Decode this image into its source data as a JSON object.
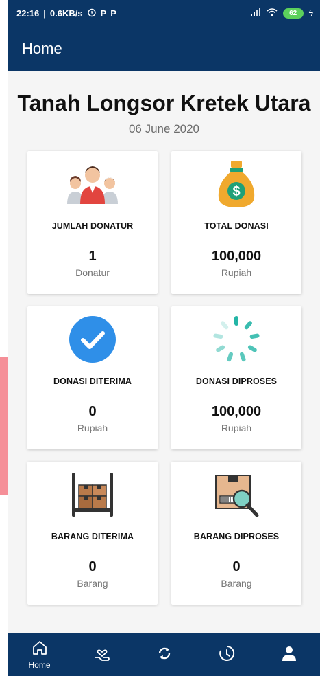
{
  "status_bar": {
    "time": "22:16",
    "speed": "0.6KB/s",
    "battery": "62"
  },
  "app_bar": {
    "title": "Home"
  },
  "header": {
    "title": "Tanah Longsor Kretek Utara",
    "date": "06 June 2020"
  },
  "cards": [
    {
      "icon": "donors-group-icon",
      "label": "JUMLAH DONATUR",
      "value": "1",
      "unit": "Donatur"
    },
    {
      "icon": "money-bag-icon",
      "label": "TOTAL DONASI",
      "value": "100,000",
      "unit": "Rupiah"
    },
    {
      "icon": "check-circle-icon",
      "label": "DONASI DITERIMA",
      "value": "0",
      "unit": "Rupiah"
    },
    {
      "icon": "loading-spinner-icon",
      "label": "DONASI DIPROSES",
      "value": "100,000",
      "unit": "Rupiah"
    },
    {
      "icon": "warehouse-boxes-icon",
      "label": "BARANG DITERIMA",
      "value": "0",
      "unit": "Barang"
    },
    {
      "icon": "box-search-icon",
      "label": "BARANG DIPROSES",
      "value": "0",
      "unit": "Barang"
    }
  ],
  "bottom_nav": [
    {
      "icon": "home-icon",
      "label": "Home"
    },
    {
      "icon": "donate-hand-icon",
      "label": ""
    },
    {
      "icon": "refresh-icon",
      "label": ""
    },
    {
      "icon": "history-clock-icon",
      "label": ""
    },
    {
      "icon": "profile-icon",
      "label": ""
    }
  ],
  "colors": {
    "primary": "#0b3666",
    "background": "#f5f5f5",
    "check_blue": "#2f8fe8",
    "spinner_teal": "#23b5a6",
    "money_bag": "#f0a92e"
  }
}
